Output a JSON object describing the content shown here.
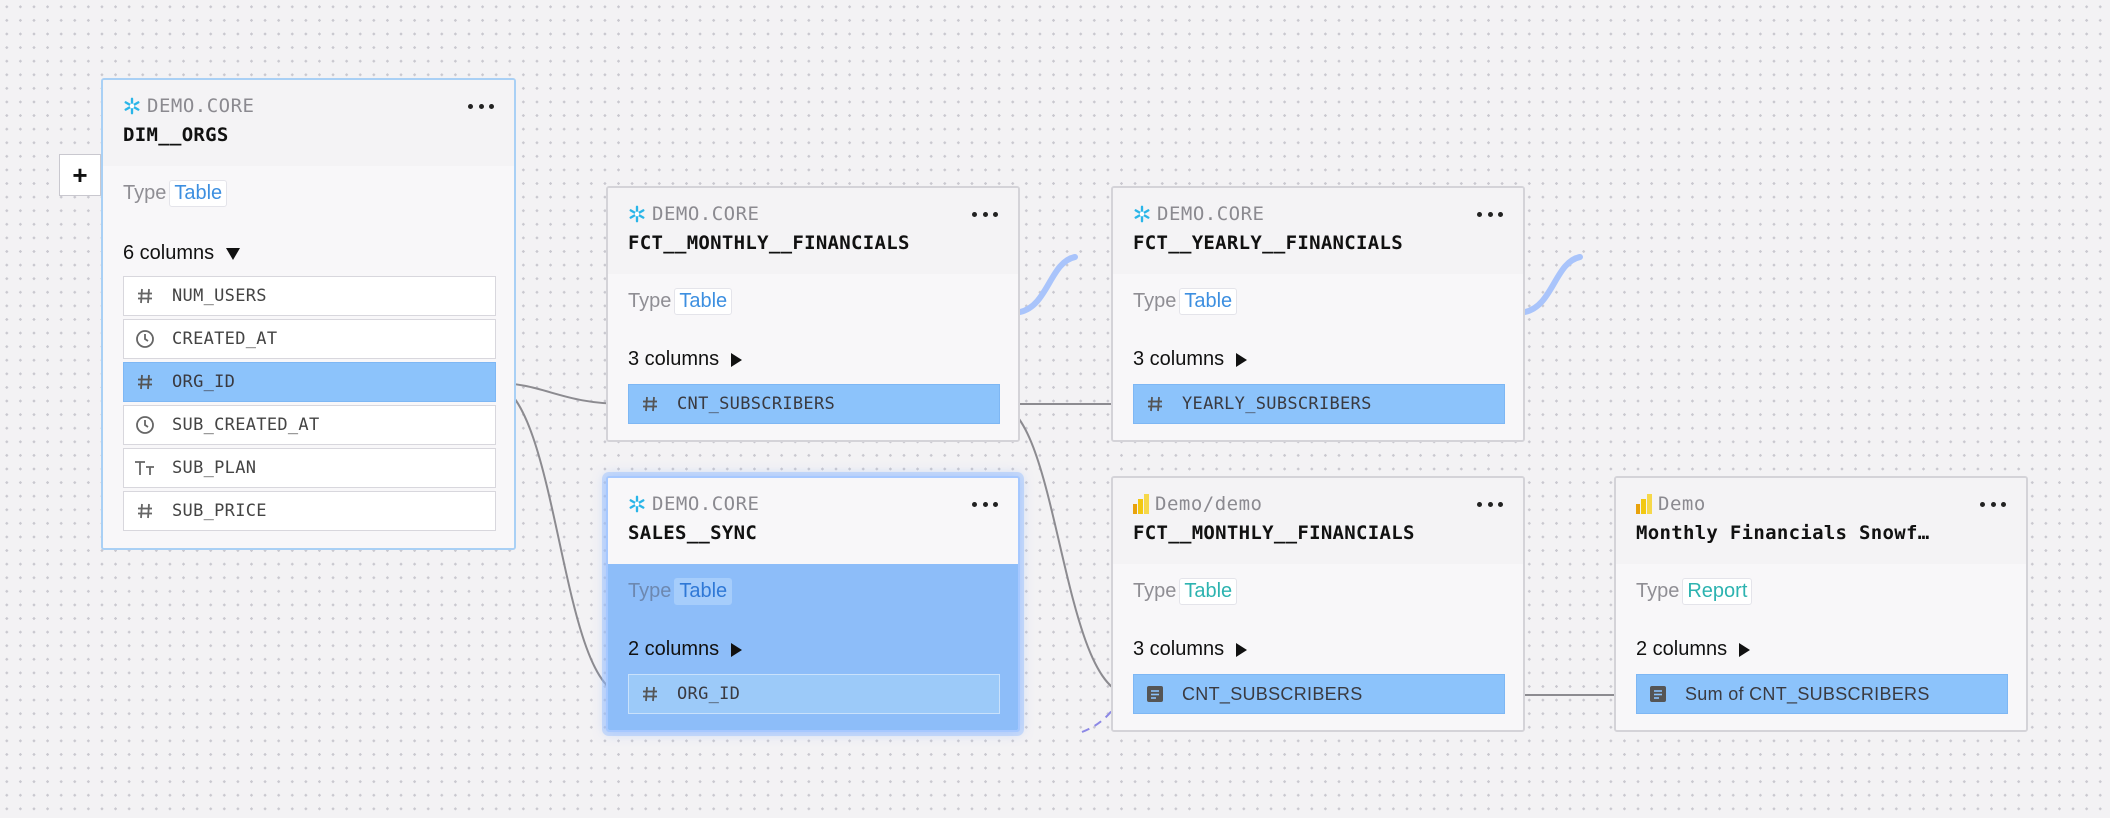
{
  "toolbar": {
    "add_label": "+"
  },
  "nodes": {
    "dim_orgs": {
      "source": "DEMO.CORE",
      "name": "DIM__ORGS",
      "type_label": "Type",
      "type_value": "Table",
      "columns_label": "6 columns",
      "columns": [
        {
          "icon": "hash-icon",
          "label": "NUM_USERS"
        },
        {
          "icon": "clock-icon",
          "label": "CREATED_AT"
        },
        {
          "icon": "hash-icon",
          "label": "ORG_ID"
        },
        {
          "icon": "clock-icon",
          "label": "SUB_CREATED_AT"
        },
        {
          "icon": "text-type-icon",
          "label": "SUB_PLAN"
        },
        {
          "icon": "hash-icon",
          "label": "SUB_PRICE"
        }
      ]
    },
    "fct_monthly": {
      "source": "DEMO.CORE",
      "name": "FCT__MONTHLY__FINANCIALS",
      "type_label": "Type",
      "type_value": "Table",
      "columns_label": "3 columns",
      "columns": [
        {
          "icon": "hash-icon",
          "label": "CNT_SUBSCRIBERS"
        }
      ]
    },
    "fct_yearly": {
      "source": "DEMO.CORE",
      "name": "FCT__YEARLY__FINANCIALS",
      "type_label": "Type",
      "type_value": "Table",
      "columns_label": "3 columns",
      "columns": [
        {
          "icon": "hash-icon",
          "label": "YEARLY_SUBSCRIBERS"
        }
      ]
    },
    "sales_sync": {
      "source": "DEMO.CORE",
      "name": "SALES__SYNC",
      "type_label": "Type",
      "type_value": "Table",
      "columns_label": "2 columns",
      "columns": [
        {
          "icon": "hash-icon",
          "label": "ORG_ID"
        }
      ]
    },
    "pbi_dataset": {
      "source": "Demo/demo",
      "name": "FCT__MONTHLY__FINANCIALS",
      "type_label": "Type",
      "type_value": "Table",
      "columns_label": "3 columns",
      "columns": [
        {
          "icon": "measure-icon",
          "label": "CNT_SUBSCRIBERS"
        }
      ]
    },
    "pbi_report": {
      "source": "Demo",
      "name": "Monthly Financials Snowf…",
      "type_label": "Type",
      "type_value": "Report",
      "columns_label": "2 columns",
      "columns": [
        {
          "icon": "measure-icon",
          "label": "Sum of CNT_SUBSCRIBERS"
        }
      ]
    }
  },
  "colors": {
    "snowflake": "#29b5e8",
    "powerbi": "#f2c811",
    "edge": "#8c8b90",
    "highlight": "#8cc3fb",
    "type_link": "#3d8fe0",
    "report_type": "#2db3b0"
  }
}
